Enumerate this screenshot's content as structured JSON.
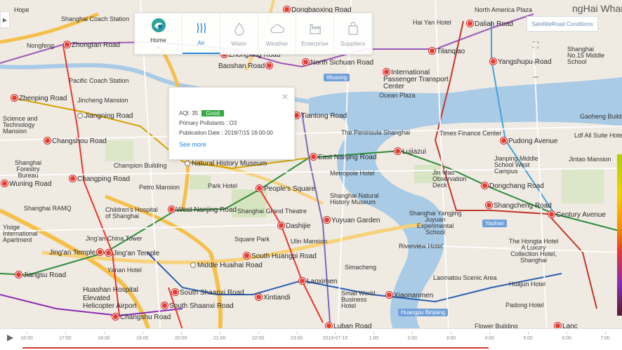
{
  "nav": {
    "items": [
      {
        "label": "Home",
        "icon": "home-logo-icon"
      },
      {
        "label": "Air",
        "icon": "air-icon"
      },
      {
        "label": "Water",
        "icon": "water-drop-icon"
      },
      {
        "label": "Weather",
        "icon": "cloud-icon"
      },
      {
        "label": "Enterprise",
        "icon": "factory-icon"
      },
      {
        "label": "Suppliers",
        "icon": "bag-icon"
      }
    ]
  },
  "popup": {
    "aqi_label": "AQI:",
    "aqi_value": "35",
    "aqi_status": "Good",
    "pollutants": "Primary Pollutants : O3",
    "published": "Publication Date : 2019/7/15 16:00:00",
    "see_more": "See more"
  },
  "controls": {
    "map_type": "SatelliteRoad Conditions",
    "zoom_in": "+",
    "zoom_out": "−"
  },
  "map_labels": {
    "stations": [
      "Dongbaoxing Road",
      "Zhongtan Road",
      "Zhongxing Road",
      "Baoshan Road",
      "North Sichuan Road",
      "International Passenger Transport Center",
      "Dalian Road",
      "Tilanqiao",
      "Yangshupu Road",
      "Zhenping Road",
      "Jiangning Road",
      "Tiantong Road",
      "Changshou Road",
      "East Nanjing Road",
      "Lujiazui",
      "Pudong Avenue",
      "Natural History Museum",
      "Changping Road",
      "People's Square",
      "Dongchang Road",
      "Wuning Road",
      "West Nanjing Road",
      "Dashijie",
      "Yuyuan Garden",
      "Shangcheng Road",
      "Century Avenue",
      "Jing'an Temple",
      "Jing'an Temple",
      "South Huangpi Road",
      "Middle Huaihai Road",
      "Jiangsu Road",
      "Laoximen",
      "Xiaonanmen",
      "South Shaanxi Road",
      "South Shaanxi Road",
      "Xintiandi",
      "Changshu Road",
      "Luban Road",
      "Lanc"
    ],
    "places": [
      "Shanghai Coach Station",
      "Pacific Coach Station",
      "Jincheng Mansion",
      "Shanghai Forestry Bureau",
      "Champion Building",
      "Petro Mansion",
      "Shanghai RAMQ",
      "Children's Hospital of Shanghai",
      "Jing'an China Tower",
      "Yanan Hotel",
      "Huashan Hospital",
      "Elevated Helicopter Airport",
      "Ocean Plaza",
      "The Peninsula Shanghai",
      "Times Finance Center",
      "Metropole Hotel",
      "Jin Mao Observation Deck",
      "Shanghai Natural History Museum",
      "Shanghai Grand Theatre",
      "Square Park",
      "Ulin Mansion",
      "Simacheng",
      "Small World Business Hotel",
      "Riverview Hotel",
      "Laomatou Scenic Area",
      "The Hongta Hotel A Luxury Collection Hotel, Shanghai",
      "Huajun Hotel",
      "Padong Hotel",
      "Flower Building",
      "Shanghai Yangjing Juyuan Experimental School",
      "Jianping Middle School West Campus",
      "Jintao Mansion",
      "Ldf All Suite Hotel",
      "Gaoheng Building",
      "Shanghai No.15 Middle School",
      "Hai Yan Hotel",
      "North America Plaza",
      "Park Hotel",
      "Hope",
      "Nongfeng",
      "Science and Technology Mansion",
      "Yisige International Apartment"
    ],
    "districts": [
      "Wusong",
      "Yaohan",
      "Huangpu Binjiang",
      "ngHai Wharf"
    ]
  },
  "timeline": {
    "ticks": [
      "16:00",
      "17:00",
      "18:00",
      "19:00",
      "20:00",
      "21:00",
      "22:00",
      "23:00",
      "2019-07-15",
      "1:00",
      "2:00",
      "3:00",
      "4:00",
      "5:00",
      "6:00",
      "7:00"
    ],
    "progress": 0.8
  },
  "colors": {
    "accent": "#2a88d8",
    "good": "#35a845",
    "metro_red": "#e63a32",
    "progress": "#d23c35"
  }
}
